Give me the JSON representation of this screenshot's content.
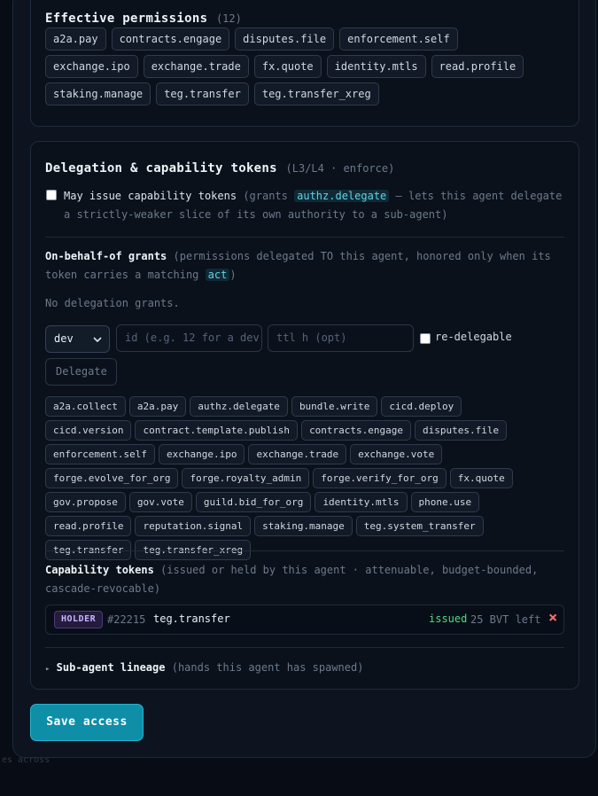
{
  "backdrop": {
    "footer_fragment": "es across"
  },
  "effective": {
    "title": "Effective permissions",
    "count": "(12)",
    "permissions": [
      "a2a.pay",
      "contracts.engage",
      "disputes.file",
      "enforcement.self",
      "exchange.ipo",
      "exchange.trade",
      "fx.quote",
      "identity.mtls",
      "read.profile",
      "staking.manage",
      "teg.transfer",
      "teg.transfer_xreg"
    ]
  },
  "delegation": {
    "title": "Delegation & capability tokens",
    "subtitle": "(L3/L4 · enforce)",
    "issue_label": "May issue capability tokens",
    "issue_hint_pre": "(grants",
    "issue_hint_code": "authz.delegate",
    "issue_hint_post": "— lets this agent delegate",
    "issue_hint_line2": "a strictly-weaker slice of its own authority to a sub-agent)",
    "issue_checked": false,
    "obo_title": "On-behalf-of grants",
    "obo_hint_pre": "(permissions delegated TO this agent, honored only when its",
    "obo_hint_line2_pre": "token carries a matching",
    "obo_hint_code": "act",
    "obo_hint_line2_post": ")",
    "no_grants": "No delegation grants.",
    "form": {
      "type_value": "dev",
      "id_placeholder": "id (e.g. 12 for a dev,",
      "ttl_placeholder": "ttl h (opt)",
      "redelegable_label": "re-delegable",
      "redelegable_checked": false,
      "delegate_button": "Delegate"
    },
    "grantable": [
      "a2a.collect",
      "a2a.pay",
      "authz.delegate",
      "bundle.write",
      "cicd.deploy",
      "cicd.version",
      "contract.template.publish",
      "contracts.engage",
      "disputes.file",
      "enforcement.self",
      "exchange.ipo",
      "exchange.trade",
      "exchange.vote",
      "forge.evolve_for_org",
      "forge.royalty_admin",
      "forge.verify_for_org",
      "fx.quote",
      "gov.propose",
      "gov.vote",
      "guild.bid_for_org",
      "identity.mtls",
      "phone.use",
      "read.profile",
      "reputation.signal",
      "staking.manage",
      "teg.system_transfer",
      "teg.transfer",
      "teg.transfer_xreg"
    ],
    "cap_title": "Capability tokens",
    "cap_hint": "(issued or held by this agent · attenuable, budget-bounded,",
    "cap_hint_line2": "cascade-revocable)",
    "token": {
      "role": "HOLDER",
      "id": "#22215",
      "scope": "teg.transfer",
      "status": "issued",
      "budget": "25 BVT left",
      "revoke_glyph": "×"
    },
    "lineage_caret": "▸",
    "lineage_title": "Sub-agent lineage",
    "lineage_hint": "(hands this agent has spawned)"
  },
  "save_button": "Save access",
  "colors": {
    "accent": "#0f8ea8",
    "issued": "#4ade80",
    "revoke": "#f87171",
    "holder": "#c4b5fd"
  }
}
